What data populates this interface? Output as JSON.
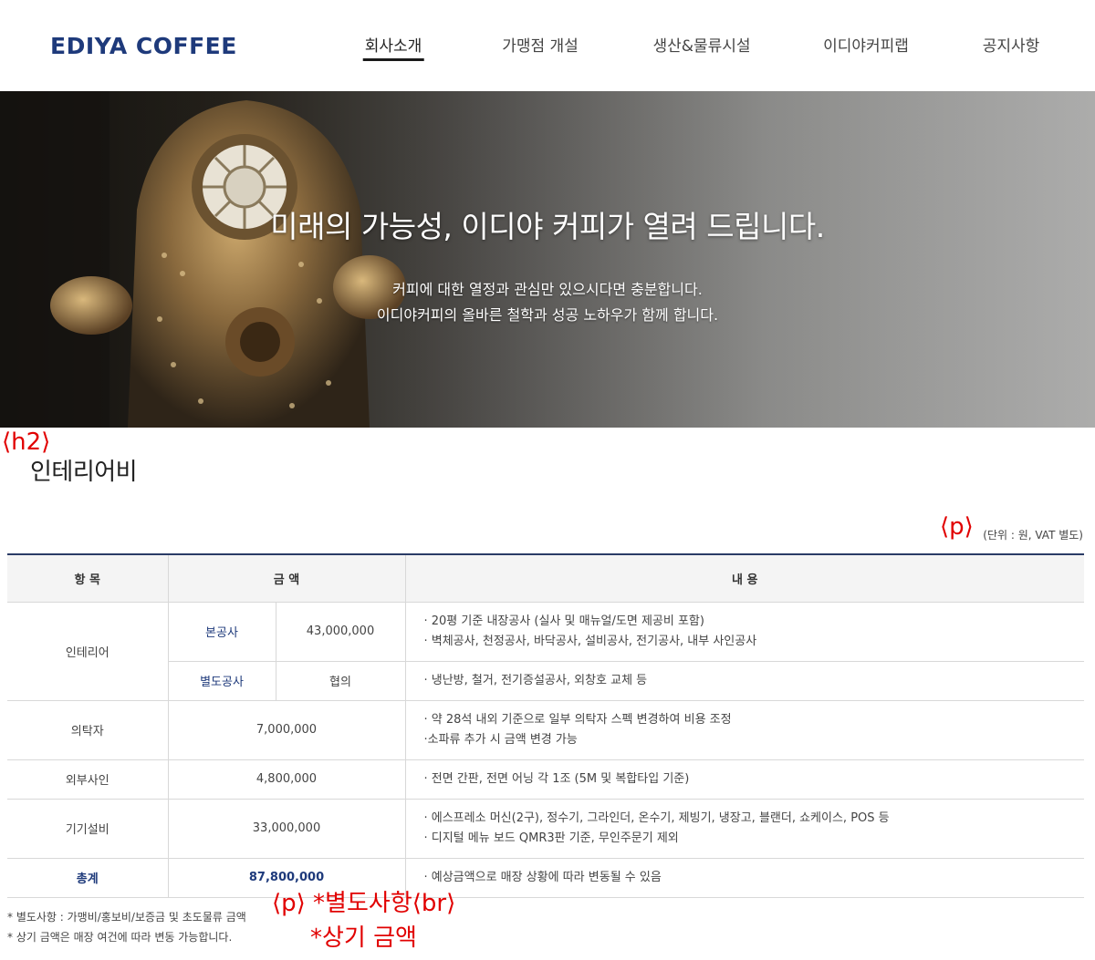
{
  "header": {
    "logo": "EDIYA COFFEE",
    "nav": [
      {
        "label": "회사소개",
        "active": true
      },
      {
        "label": "가맹점 개설",
        "active": false
      },
      {
        "label": "생산&물류시설",
        "active": false
      },
      {
        "label": "이디야커피랩",
        "active": false
      },
      {
        "label": "공지사항",
        "active": false
      }
    ]
  },
  "hero": {
    "title": "미래의 가능성, 이디야 커피가 열려 드립니다.",
    "line1": "커피에 대한 열정과 관심만 있으시다면 충분합니다.",
    "line2": "이디야커피의 올바른 철학과 성공 노하우가 함께 합니다."
  },
  "annotations": {
    "h2": "⟨h2⟩",
    "p": "⟨p⟩",
    "p_br_line1": "⟨p⟩ *별도사항⟨br⟩",
    "p_br_line2": "*상기 금액"
  },
  "section": {
    "title": "인테리어비",
    "unit": "(단위 : 원, VAT 별도)"
  },
  "table": {
    "headers": {
      "item": "항 목",
      "amount": "금 액",
      "content": "내 용"
    },
    "interior": {
      "label": "인테리어",
      "main_label": "본공사",
      "main_amount": "43,000,000",
      "main_desc1": "· 20평 기준 내장공사 (실사 및 매뉴얼/도면 제공비 포함)",
      "main_desc2": "· 벽체공사, 천정공사, 바닥공사, 설비공사, 전기공사, 내부 사인공사",
      "extra_label": "별도공사",
      "extra_amount": "협의",
      "extra_desc": "· 냉난방, 철거, 전기증설공사, 외창호 교체 등"
    },
    "furniture": {
      "label": "의탁자",
      "amount": "7,000,000",
      "desc1": "· 약 28석 내외 기준으로 일부 의탁자 스펙 변경하여 비용 조정",
      "desc2": "·소파류 추가 시 금액 변경 가능"
    },
    "signage": {
      "label": "외부사인",
      "amount": "4,800,000",
      "desc": "· 전면 간판, 전면 어닝 각 1조 (5M 및 복합타입 기준)"
    },
    "equipment": {
      "label": "기기설비",
      "amount": "33,000,000",
      "desc1": "· 에스프레소 머신(2구), 정수기, 그라인더, 온수기, 제빙기, 냉장고, 블랜더, 쇼케이스, POS 등",
      "desc2": "· 디지털 메뉴 보드 QMR3판 기준, 무인주문기 제외"
    },
    "total": {
      "label": "총계",
      "amount": "87,800,000",
      "desc": "· 예상금액으로 매장 상황에 따라 변동될 수 있음"
    }
  },
  "notes": {
    "note1": "* 별도사항 : 가맹비/홍보비/보증금 및 초도물류 금액",
    "note2": "* 상기 금액은 매장 여건에 따라 변동 가능합니다."
  }
}
